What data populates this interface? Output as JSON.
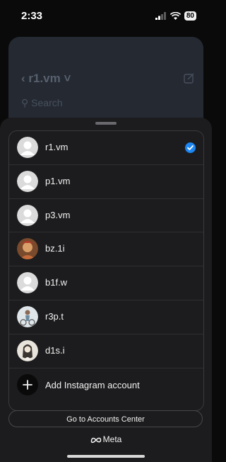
{
  "status_bar": {
    "time": "2:33",
    "battery": "80"
  },
  "background": {
    "title": "r1.vm",
    "search_placeholder": "Search"
  },
  "accounts": [
    {
      "username": "r1.vm",
      "avatar": "default-avatar-icon",
      "selected": true
    },
    {
      "username": "p1.vm",
      "avatar": "default-avatar-icon",
      "selected": false
    },
    {
      "username": "p3.vm",
      "avatar": "default-avatar-icon",
      "selected": false
    },
    {
      "username": "bz.1i",
      "avatar": "photo-avatar",
      "selected": false
    },
    {
      "username": "b1f.w",
      "avatar": "default-avatar-icon",
      "selected": false
    },
    {
      "username": "r3p.t",
      "avatar": "photo-avatar",
      "selected": false
    },
    {
      "username": "d1s.i",
      "avatar": "photo-avatar",
      "selected": false
    }
  ],
  "add_account": {
    "label": "Add Instagram account",
    "icon": "plus-icon"
  },
  "accounts_center": {
    "label": "Go to Accounts Center"
  },
  "footer": {
    "brand": "Meta",
    "icon": "meta-logo-icon"
  },
  "colors": {
    "sheet": "#1c1c1e",
    "accent": "#1d86f2",
    "text": "#f2f2f2"
  }
}
